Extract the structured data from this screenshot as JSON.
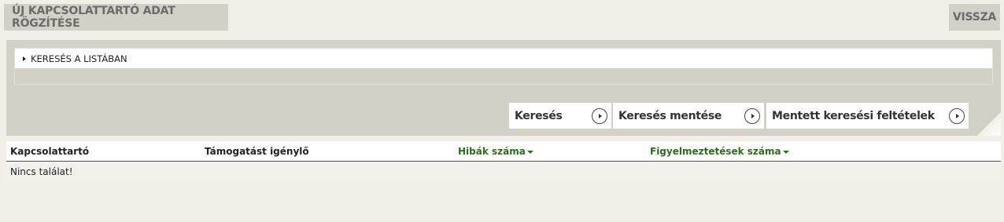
{
  "header": {
    "new_contact_label": "ÚJ KAPCSOLATTARTÓ ADAT RÖGZÍTÉSE",
    "back_label": "VISSZA"
  },
  "search": {
    "toggle_label": "KERESÉS A LISTÁBAN"
  },
  "actions": {
    "search_label": "Keresés",
    "save_search_label": "Keresés mentése",
    "saved_criteria_label": "Mentett keresési feltételek"
  },
  "table": {
    "columns": [
      {
        "label": "Kapcsolattartó",
        "sortable": false
      },
      {
        "label": "Támogatást igénylő",
        "sortable": false
      },
      {
        "label": "Hibák száma",
        "sortable": true
      },
      {
        "label": "Figyelmeztetések száma",
        "sortable": true
      }
    ],
    "empty_message": "Nincs találat!"
  },
  "colors": {
    "background": "#f2efe8",
    "panel": "#d3d0c8",
    "sort_header": "#2e6b1f"
  }
}
